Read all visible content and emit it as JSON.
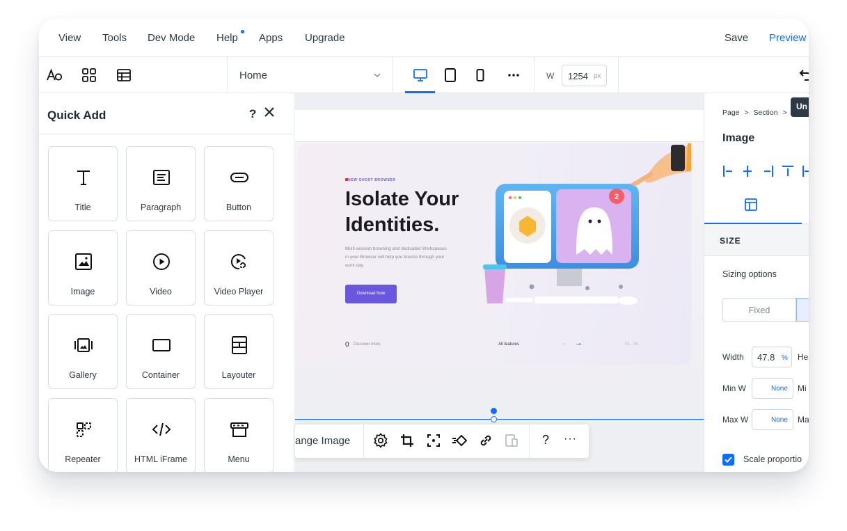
{
  "menu": {
    "items": [
      "View",
      "Tools",
      "Dev Mode",
      "Help",
      "Apps",
      "Upgrade"
    ],
    "save": "Save",
    "preview": "Preview"
  },
  "toolbar": {
    "page_select": "Home",
    "width_label": "W",
    "width_value": "1254",
    "width_unit": "px"
  },
  "quick_add": {
    "title": "Quick Add",
    "help": "?",
    "tiles": [
      {
        "label": "Title",
        "icon": "title-icon"
      },
      {
        "label": "Paragraph",
        "icon": "paragraph-icon"
      },
      {
        "label": "Button",
        "icon": "button-icon"
      },
      {
        "label": "Image",
        "icon": "image-icon"
      },
      {
        "label": "Video",
        "icon": "video-icon"
      },
      {
        "label": "Video Player",
        "icon": "video-player-icon"
      },
      {
        "label": "Gallery",
        "icon": "gallery-icon"
      },
      {
        "label": "Container",
        "icon": "container-icon"
      },
      {
        "label": "Layouter",
        "icon": "layouter-icon"
      },
      {
        "label": "Repeater",
        "icon": "repeater-icon"
      },
      {
        "label": "HTML iFrame",
        "icon": "html-iframe-icon"
      },
      {
        "label": "Menu",
        "icon": "menu-icon"
      }
    ]
  },
  "hero": {
    "tag": "NEW GHOST BROWSER",
    "headline_1": "Isolate Your",
    "headline_2": "Identities.",
    "body": "Multi-session browsing and dedicated Workspaces in your Browser will help you breeze through your work day.",
    "button": "Download Now",
    "discover": "Discover more",
    "features": "All features",
    "pager": "01 . 04",
    "badge": "2"
  },
  "image_toolbar": {
    "change_image": "ange Image",
    "help": "?",
    "more": "···"
  },
  "inspector": {
    "breadcrumb_page": "Page",
    "breadcrumb_section": "Section",
    "tooltip": "Un",
    "title": "Image",
    "size_heading": "SIZE",
    "sizing_options": "Sizing options",
    "fixed": "Fixed",
    "width_label": "Width",
    "width_value": "47.8",
    "width_unit": "%",
    "height_label": "He",
    "min_w_label": "Min W",
    "min_w_value": "None",
    "min_h_label": "Mi",
    "max_w_label": "Max W",
    "max_w_value": "None",
    "max_h_label": "Ma",
    "scale_label": "Scale proportio"
  },
  "colors": {
    "accent": "#116dff",
    "hero_button": "#6a57e0"
  }
}
